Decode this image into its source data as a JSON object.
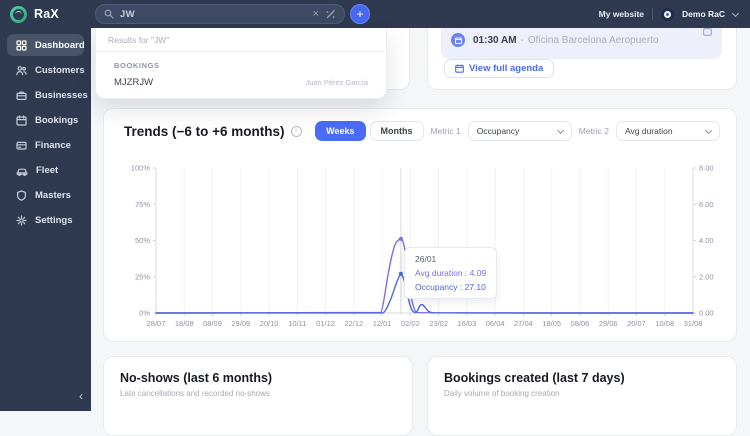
{
  "sidebar": {
    "logo_text": "RaX",
    "items": [
      {
        "label": "Dashboard",
        "icon": "dashboard-icon",
        "active": true
      },
      {
        "label": "Customers",
        "icon": "customers-icon",
        "active": false
      },
      {
        "label": "Businesses",
        "icon": "businesses-icon",
        "active": false
      },
      {
        "label": "Bookings",
        "icon": "bookings-icon",
        "active": false
      },
      {
        "label": "Finance",
        "icon": "finance-icon",
        "active": false
      },
      {
        "label": "Fleet",
        "icon": "fleet-icon",
        "active": false
      },
      {
        "label": "Masters",
        "icon": "masters-icon",
        "active": false
      },
      {
        "label": "Settings",
        "icon": "settings-icon",
        "active": false
      }
    ]
  },
  "topbar": {
    "search_value": "JW",
    "clear_icon": "×",
    "add_button_label": "+",
    "my_website_label": "My website",
    "account_name": "Demo RaC"
  },
  "search_dropdown": {
    "results_header": "Results for \"JW\"",
    "section_label": "BOOKINGS",
    "result_code": "MJZRJW",
    "result_name": "Juan Pérez García"
  },
  "agenda_card": {
    "event_time": "01:30 AM",
    "event_separator": "-",
    "event_location": "Oficina Barcelona Aeropuerto",
    "view_full_agenda_label": "View full agenda"
  },
  "trends_card": {
    "title": "Trends (−6 to +6 months)",
    "toggle": {
      "weeks": "Weeks",
      "months": "Months",
      "selected": "Weeks"
    },
    "metric1_label": "Metric 1",
    "metric1_value": "Occupancy",
    "metric2_label": "Metric 2",
    "metric2_value": "Avg duration"
  },
  "tooltip": {
    "date": "26/01",
    "line1": "Avg duration : 4.09",
    "line2": "Occupancy : 27.10"
  },
  "chart_data": {
    "type": "line",
    "title": "Trends (−6 to +6 months)",
    "x_tick_labels": [
      "28/07",
      "18/08",
      "08/09",
      "29/09",
      "20/10",
      "10/11",
      "01/12",
      "22/12",
      "12/01",
      "02/02",
      "23/02",
      "16/03",
      "06/04",
      "27/04",
      "18/05",
      "08/06",
      "29/06",
      "20/07",
      "10/08",
      "31/08"
    ],
    "left_axis": {
      "ticks": [
        "100%",
        "75%",
        "50%",
        "25%",
        "0%"
      ],
      "min": 0,
      "max": 100
    },
    "right_axis": {
      "ticks": [
        "8.00",
        "6.00",
        "4.00",
        "2.00",
        "0.00"
      ],
      "min": 0,
      "max": 8
    },
    "grid": true,
    "hover": {
      "x_frac": 0.4561,
      "date": "26/01",
      "points": [
        {
          "series": "Avg duration",
          "value": 4.09
        },
        {
          "series": "Occupancy",
          "value": 27.1
        }
      ]
    },
    "series": [
      {
        "name": "Avg duration",
        "axis": "right",
        "color": "#7e6bea",
        "points": [
          [
            0,
            0
          ],
          [
            0.415,
            0
          ],
          [
            0.4211,
            0.05
          ],
          [
            0.432,
            2.2
          ],
          [
            0.444,
            3.8
          ],
          [
            0.452,
            4.05
          ],
          [
            0.4561,
            4.09
          ],
          [
            0.461,
            3.95
          ],
          [
            0.468,
            2.6
          ],
          [
            0.475,
            0.8
          ],
          [
            0.4825,
            0.05
          ],
          [
            0.49,
            0
          ],
          [
            1,
            0
          ]
        ]
      },
      {
        "name": "Occupancy",
        "axis": "left",
        "color": "#4a67dd",
        "points": [
          [
            0,
            0
          ],
          [
            0.418,
            0
          ],
          [
            0.4255,
            0.1
          ],
          [
            0.436,
            8
          ],
          [
            0.447,
            20
          ],
          [
            0.453,
            25.5
          ],
          [
            0.4561,
            27.1
          ],
          [
            0.4615,
            24
          ],
          [
            0.468,
            13
          ],
          [
            0.4745,
            3
          ],
          [
            0.4805,
            0.2
          ],
          [
            0.486,
            0.5
          ],
          [
            0.4912,
            5.5
          ],
          [
            0.4965,
            6
          ],
          [
            0.503,
            3
          ],
          [
            0.509,
            0.3
          ],
          [
            0.5263,
            0
          ],
          [
            1,
            0
          ]
        ]
      }
    ]
  },
  "bottom_cards": [
    {
      "title": "No-shows (last 6 months)",
      "subtitle": "Late cancellations and recorded no-shows"
    },
    {
      "title": "Bookings created (last 7 days)",
      "subtitle": "Daily volume of booking creation"
    }
  ],
  "colors": {
    "accent_blue": "#4a6bf5",
    "line_purple": "#7e6bea",
    "line_blue": "#4a67dd",
    "sidebar_bg": "#2f3a51",
    "event_row_bg": "#edeffb"
  }
}
